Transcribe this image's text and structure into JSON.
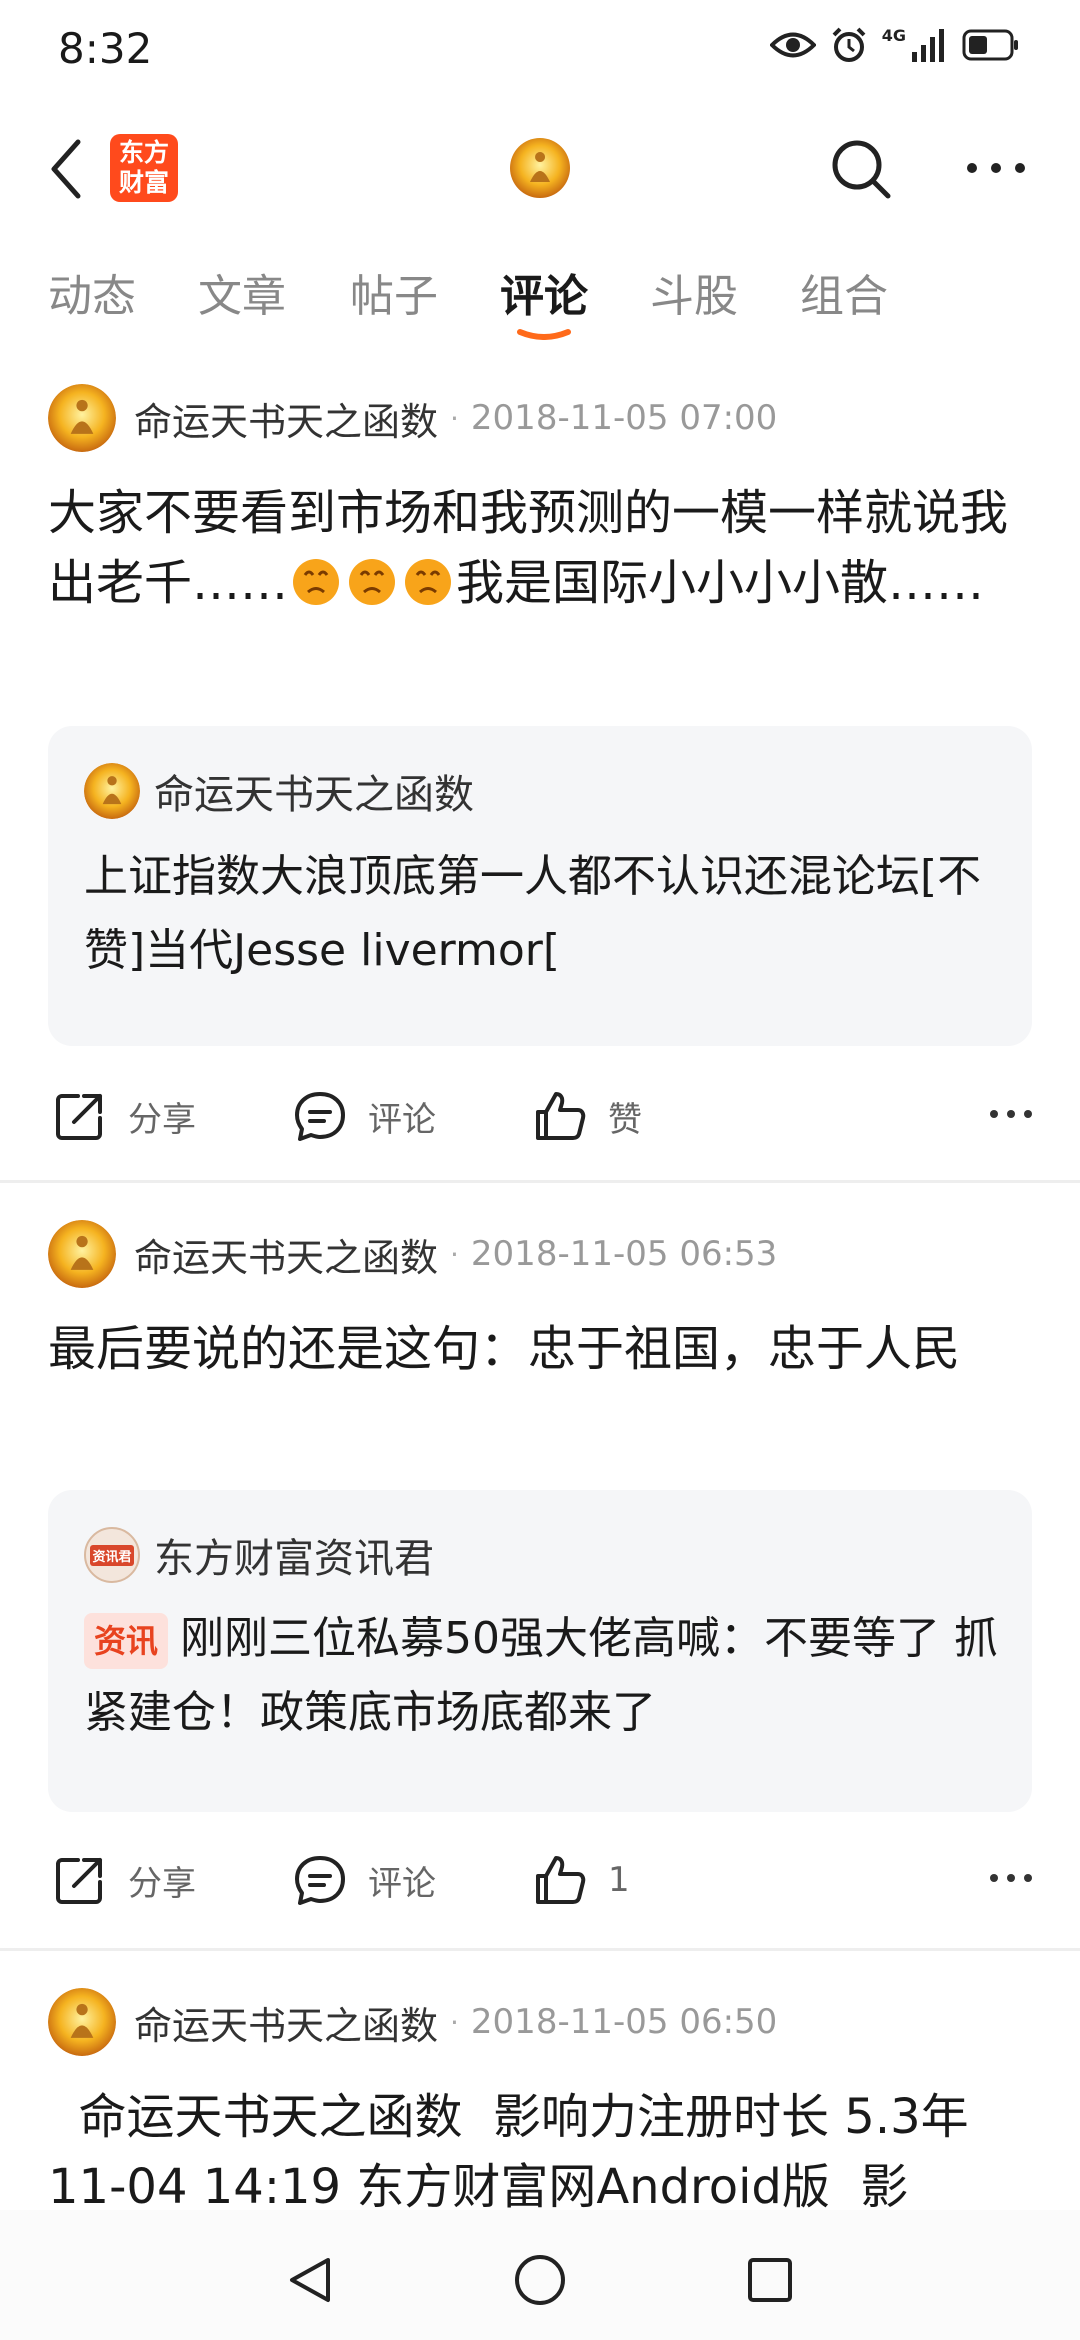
{
  "status": {
    "time": "8:32",
    "network": "4G"
  },
  "header": {
    "logo_text": "东方财富"
  },
  "tabs": [
    "动态",
    "文章",
    "帖子",
    "评论",
    "斗股",
    "组合"
  ],
  "posts": [
    {
      "author": "命运天书天之函数",
      "time": "2018-11-05 07:00",
      "text_a": "大家不要看到市场和我预测的一模一样就说我出老千……",
      "text_b": "我是国际小小小小散……",
      "quote": {
        "author": "命运天书天之函数",
        "text": "上证指数大浪顶底第一人都不认识还混论坛[不赞]当代Jesse livermor["
      },
      "actions": {
        "share": "分享",
        "comment": "评论",
        "like": "赞"
      }
    },
    {
      "author": "命运天书天之函数",
      "time": "2018-11-05 06:53",
      "text": "最后要说的还是这句：忠于祖国，忠于人民",
      "quote": {
        "author": "东方财富资讯君",
        "avatar_text": "资讯君",
        "tag": "资讯",
        "text": "刚刚三位私募50强大佬高喊：不要等了 抓紧建仓！政策底市场底都来了"
      },
      "actions": {
        "share": "分享",
        "comment": "评论",
        "like": "1"
      }
    },
    {
      "author": "命运天书天之函数",
      "time": "2018-11-05 06:50",
      "text": "  命运天书天之函数  影响力注册时长 5.3年  11-04 14:19 东方财富网Android版  影"
    }
  ],
  "colors": {
    "accent": "#ff4a1c",
    "tab_indicator": "#ff6a1a",
    "tag_bg": "#fde1dc",
    "tag_text": "#e8431f"
  }
}
